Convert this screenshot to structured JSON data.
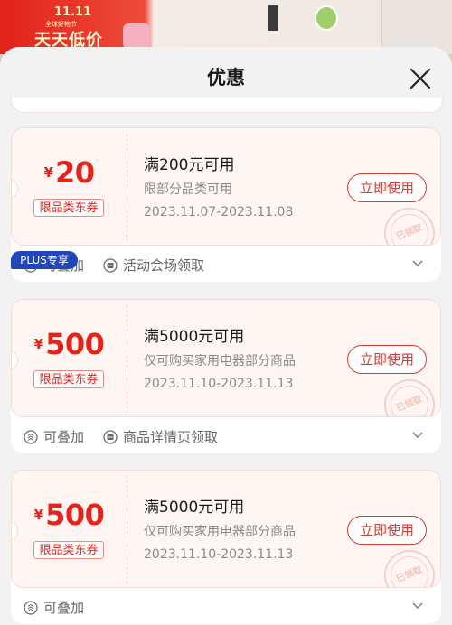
{
  "background": {
    "promo_line1": "11.11",
    "promo_line2": "全球好物节",
    "promo_line3": "天天低价"
  },
  "sheet": {
    "title": "优惠"
  },
  "coupons": [
    {
      "currency": "¥",
      "amount": "20",
      "tag": "限品类东券",
      "condition": "满200元可用",
      "scope": "限部分品类可用",
      "date": "2023.11.07-2023.11.08",
      "button": "立即使用",
      "stamp": "已领取",
      "feature1": "可叠加",
      "feature2": "活动会场领取"
    },
    {
      "badge": "PLUS专享",
      "currency": "¥",
      "amount": "500",
      "tag": "限品类东券",
      "condition": "满5000元可用",
      "scope": "仅可购买家用电器部分商品",
      "date": "2023.11.10-2023.11.13",
      "button": "立即使用",
      "stamp": "已领取",
      "feature1": "可叠加",
      "feature2": "商品详情页领取"
    },
    {
      "currency": "¥",
      "amount": "500",
      "tag": "限品类东券",
      "condition": "满5000元可用",
      "scope": "仅可购买家用电器部分商品",
      "date": "2023.11.10-2023.11.13",
      "button": "立即使用",
      "stamp": "已领取",
      "feature1": "可叠加"
    }
  ],
  "colors": {
    "accent": "#e4231a",
    "plus_badge": "#2146b8"
  }
}
